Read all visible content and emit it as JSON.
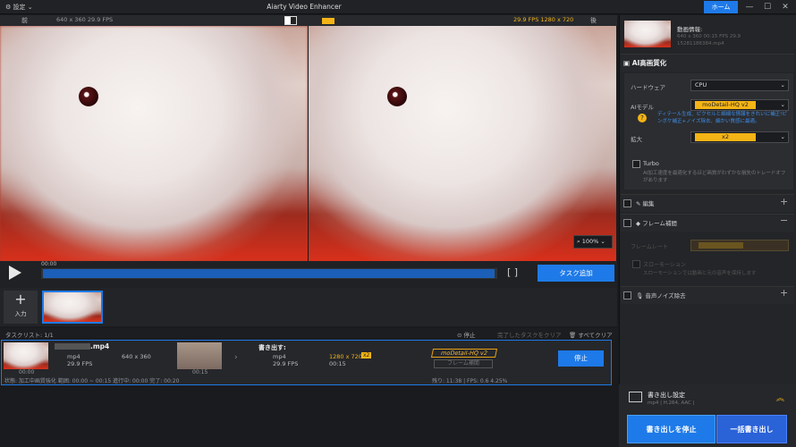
{
  "titlebar": {
    "settings": "設定",
    "title": "Aiarty Video Enhancer",
    "home": "ホーム"
  },
  "preview": {
    "before": "前",
    "before_info": "640 x 360  29.9 FPS",
    "after": "後",
    "after_info": "29.9 FPS   1280 x 720",
    "zoom": "100%"
  },
  "player": {
    "time": "00:00",
    "task_add": "タスク追加"
  },
  "filmstrip": {
    "input_label": "入力"
  },
  "tasklist": {
    "title": "タスクリスト: 1/1",
    "stop": "停止",
    "clear_done": "完了したタスクをクリア",
    "clear_all": "すべてクリア"
  },
  "task": {
    "name": ".mp4",
    "format": "mp4",
    "res_in": "640 x 360",
    "fps_in": "29.9 FPS",
    "time_in": "00:00",
    "time_mid": "00:15",
    "export_label": "書き出す:",
    "out_format": "mp4",
    "out_res": "1280 x 720",
    "out_scale": "x2",
    "out_fps": "29.9 FPS",
    "out_time": "00:15",
    "model": "moDetail-HQ  v2",
    "frame_interp": "フレーム補間",
    "stop": "停止",
    "status_left": "状態: 加工中画質強化   範囲: 00:00 ~ 00:15   進行中: 00:00   完了: 00:20",
    "status_right": "残り: 11:38  |  FPS: 0.6      4.25%"
  },
  "side": {
    "info_label": "動画情報:",
    "info_line1": "640 x 360   00:15   FPS 29.9",
    "info_line2": "15281186384.mp4",
    "ai_title": "AI高画質化",
    "hw_label": "ハードウェア",
    "hw_value": "CPU",
    "model_label": "AIモデル",
    "model_value": "moDetail-HQ  v2",
    "model_desc": "ディテール生成、ピクセルと細細な情報をきれいに補正!ピンボケ補正+ノイズ除去、細かい質感に最適。",
    "scale_label": "拡大",
    "scale_value": "x2",
    "turbo_label": "Turbo",
    "turbo_desc": "AI加工速度を最適化するほど画質がわずかな損失のトレードオフがあります",
    "edit": "編集",
    "frame": "フレーム補間",
    "frame_rate": "フレームレート",
    "slowmo": "スローモーション",
    "slowmo_desc": "スローモーションでは動画と元の音声を保持します",
    "denoise": "音声ノイズ除去",
    "export_settings": "書き出し設定",
    "export_format": "mp4 | H.264, AAC |",
    "stop_export": "書き出しを停止",
    "batch_export": "一括書き出し"
  },
  "colors": {
    "accent": "#1e7ae8",
    "highlight": "#f4b416"
  }
}
